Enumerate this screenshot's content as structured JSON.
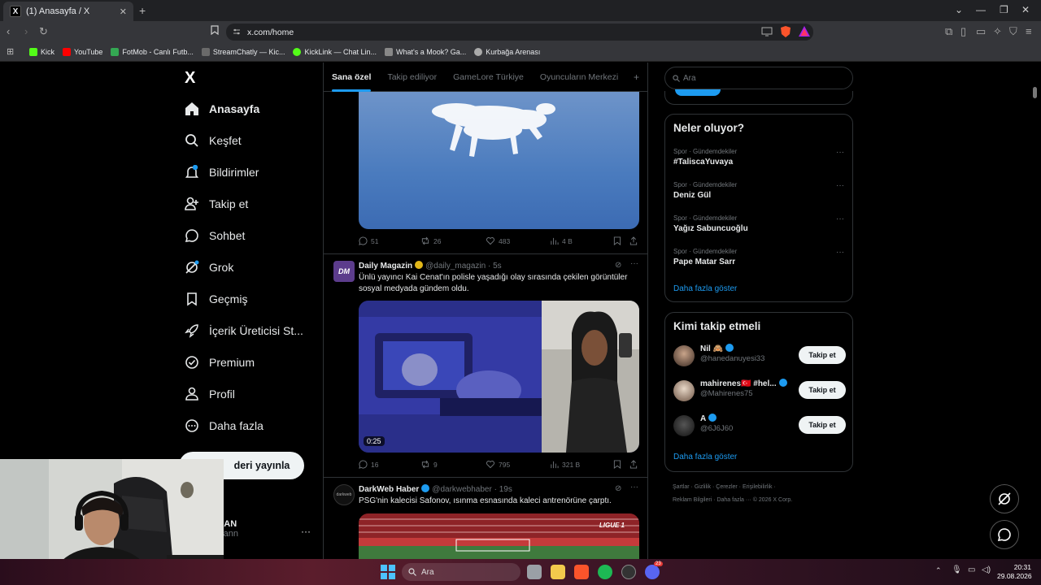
{
  "browser": {
    "tab_title": "(1) Anasayfa / X",
    "tab_favicon": "X",
    "new_tab": "+",
    "url": "x.com/home",
    "bookmarks": [
      {
        "label": "Kick",
        "color": "#53fc18"
      },
      {
        "label": "YouTube",
        "color": "#ff0000"
      },
      {
        "label": "FotMob - Canlı Futb...",
        "color": "#34a853"
      },
      {
        "label": "StreamChatly — Kic...",
        "color": "#6a6a6a"
      },
      {
        "label": "KickLink — Chat Lin...",
        "color": "#53fc18"
      },
      {
        "label": "What's a Mook? Ga...",
        "color": "#888888"
      },
      {
        "label": "Kurbağa Arenası",
        "color": "#aaaaaa"
      }
    ]
  },
  "sidebar": {
    "logo": "X",
    "items": [
      {
        "label": "Anasayfa",
        "icon": "home-icon"
      },
      {
        "label": "Keşfet",
        "icon": "search-icon"
      },
      {
        "label": "Bildirimler",
        "icon": "bell-icon",
        "badge": "1"
      },
      {
        "label": "Takip et",
        "icon": "add-user-icon"
      },
      {
        "label": "Sohbet",
        "icon": "chat-icon"
      },
      {
        "label": "Grok",
        "icon": "grok-icon"
      },
      {
        "label": "Geçmiş",
        "icon": "bookmark-icon"
      },
      {
        "label": "İçerik Üreticisi St...",
        "icon": "rocket-icon"
      },
      {
        "label": "Premium",
        "icon": "verified-icon"
      },
      {
        "label": "Profil",
        "icon": "person-icon"
      },
      {
        "label": "Daha fazla",
        "icon": "more-circle-icon"
      }
    ],
    "post_button": "Gönderiyi yayınla",
    "post_button_visible": "deri yayınla",
    "profile_name": "LGAN",
    "profile_handle": "algann"
  },
  "feed": {
    "tabs": [
      "Sana özel",
      "Takip ediliyor",
      "GameLore Türkiye",
      "Oyuncuların Merkezi"
    ],
    "tab_add": "+",
    "tweet0_actions": {
      "replies": "51",
      "reposts": "26",
      "likes": "483",
      "views": "4 B"
    },
    "tweet1": {
      "avatar": "DM",
      "name": "Daily Magazin",
      "handle": "@daily_magazin",
      "time": "· 5s",
      "text": "Ünlü yayıncı Kai Cenat'ın polisle yaşadığı olay sırasında çekilen görüntüler sosyal medyada gündem oldu.",
      "duration": "0:25",
      "actions": {
        "replies": "16",
        "reposts": "9",
        "likes": "795",
        "views": "321 B"
      }
    },
    "tweet2": {
      "avatar": "darkweb",
      "name": "DarkWeb Haber",
      "handle": "@darkwebhaber",
      "time": "· 19s",
      "text": "PSG'nin kalecisi Safonov, ısınma esnasında kaleci antrenörüne çarptı.",
      "media_brand": "LIGUE 1"
    }
  },
  "right": {
    "search_placeholder": "Ara",
    "trends_title": "Neler oluyor?",
    "trends": [
      {
        "category": "Spor · Gündemdekiler",
        "name": "#TaliscaYuvaya"
      },
      {
        "category": "Spor · Gündemdekiler",
        "name": "Deniz Gül"
      },
      {
        "category": "Spor · Gündemdekiler",
        "name": "Yağız Sabuncuoğlu"
      },
      {
        "category": "Spor · Gündemdekiler",
        "name": "Pape Matar Sarr"
      }
    ],
    "show_more": "Daha fazla göster",
    "who_title": "Kimi takip etmeli",
    "who": [
      {
        "name": "Nil 🙈",
        "handle": "@hanedanuyesi33",
        "button": "Takip et"
      },
      {
        "name": "mahirenes🇹🇷 #hel...",
        "handle": "@Mahirenes75",
        "button": "Takip et"
      },
      {
        "name": "A",
        "handle": "@6J6J60",
        "button": "Takip et"
      }
    ],
    "who_more": "Daha fazla göster",
    "footer_line1": "Şartlar   ·   Gizlilik   ·   Çerezler   ·   Erişilebilirlik   ·",
    "footer_line2": "Reklam Bilgileri   ·   Daha fazla ···   © 2026 X Corp."
  },
  "taskbar": {
    "search": "Ara",
    "time": "20:31",
    "date": "29.08.2026",
    "discord_badge": "23"
  },
  "colors": {
    "accent": "#1d9bf0",
    "background": "#000000",
    "border": "#2f3336",
    "muted": "#71767b"
  }
}
